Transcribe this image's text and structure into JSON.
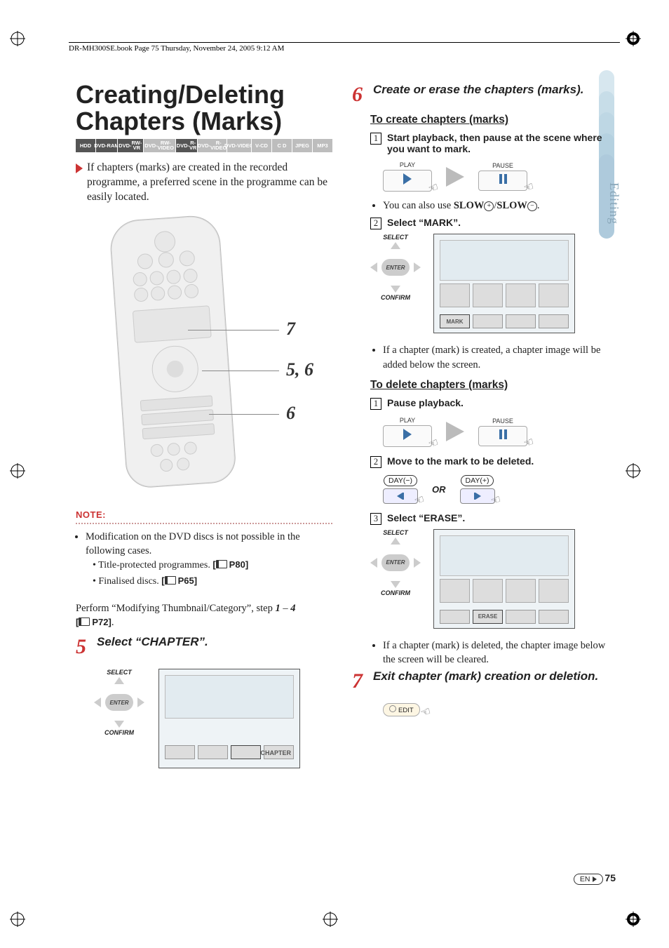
{
  "meta": {
    "header_line": "DR-MH300SE.book  Page 75  Thursday, November 24, 2005  9:12 AM"
  },
  "side_tab": "Editing",
  "title": "Creating/Deleting Chapters (Marks)",
  "badges": [
    {
      "text": "HDD",
      "tone": "dark"
    },
    {
      "text": "DVD-\nRAM",
      "tone": "dark"
    },
    {
      "text": "DVD-\nRW-VR",
      "tone": "dark"
    },
    {
      "text": "DVD-\nRW-VIDEO",
      "tone": "light"
    },
    {
      "text": "DVD-\nR-VR",
      "tone": "dark"
    },
    {
      "text": "DVD-\nR-VIDEO",
      "tone": "light"
    },
    {
      "text": "DVD-\nVIDEO",
      "tone": "light"
    },
    {
      "text": "V-CD",
      "tone": "light"
    },
    {
      "text": "C D",
      "tone": "light"
    },
    {
      "text": "JPEG",
      "tone": "light"
    },
    {
      "text": "MP3",
      "tone": "light"
    }
  ],
  "intro": "If chapters (marks) are created in the recorded programme, a preferred scene in the programme can be easily located.",
  "remote_callouts": [
    "7",
    "5, 6",
    "6"
  ],
  "note": {
    "head": "NOTE:",
    "lead": "Modification on the DVD discs is not possible in the following cases.",
    "items": [
      {
        "text": "Title-protected programmes.",
        "ref": "P80"
      },
      {
        "text": "Finalised discs.",
        "ref": "P65"
      }
    ]
  },
  "perform": {
    "text_a": "Perform ",
    "quoted": "Modifying Thumbnail/Category",
    "text_b": ", step ",
    "range_a": "1",
    "dash": " – ",
    "range_b": "4",
    "ref": "P72"
  },
  "step5": {
    "num": "5",
    "title_a": "Select ",
    "quote_open": "“",
    "word": "CHAPTER",
    "quote_close": "”",
    "title_b": ".",
    "select_label": "SELECT",
    "enter_label": "ENTER",
    "confirm_label": "CONFIRM",
    "tv_label": "CHAPTER"
  },
  "step6": {
    "num": "6",
    "title": "Create or erase the chapters (marks).",
    "create_head": "To create chapters (marks)",
    "c1": {
      "n": "1",
      "text": "Start playback, then pause at the scene where you want to mark."
    },
    "play": "PLAY",
    "pause": "PAUSE",
    "slow_line_a": "You can also use ",
    "slow_b": "SLOW",
    "slow_plus": "+",
    "slow_sep": "/",
    "slow_minus": "−",
    "slow_line_b": ".",
    "c2": {
      "n": "2",
      "text_a": "Select ",
      "word": "MARK",
      "text_b": "."
    },
    "select_label": "SELECT",
    "enter_label": "ENTER",
    "confirm_label": "CONFIRM",
    "tv_label_mark": "MARK",
    "created_note": "If a chapter (mark) is created, a chapter image will be added below the screen.",
    "delete_head": "To delete chapters (marks)",
    "d1": {
      "n": "1",
      "text": "Pause playback."
    },
    "d2": {
      "n": "2",
      "text": "Move to the mark to be deleted."
    },
    "day_minus": "DAY(−)",
    "day_plus": "DAY(+)",
    "or": "OR",
    "d3": {
      "n": "3",
      "text_a": "Select ",
      "word": "ERASE",
      "text_b": "."
    },
    "tv_label_erase": "ERASE",
    "deleted_note": "If a chapter (mark) is deleted, the chapter image below the screen will be cleared."
  },
  "step7": {
    "num": "7",
    "title": "Exit chapter (mark) creation or deletion.",
    "edit": "EDIT"
  },
  "footer": {
    "lang": "EN",
    "page": "75"
  }
}
